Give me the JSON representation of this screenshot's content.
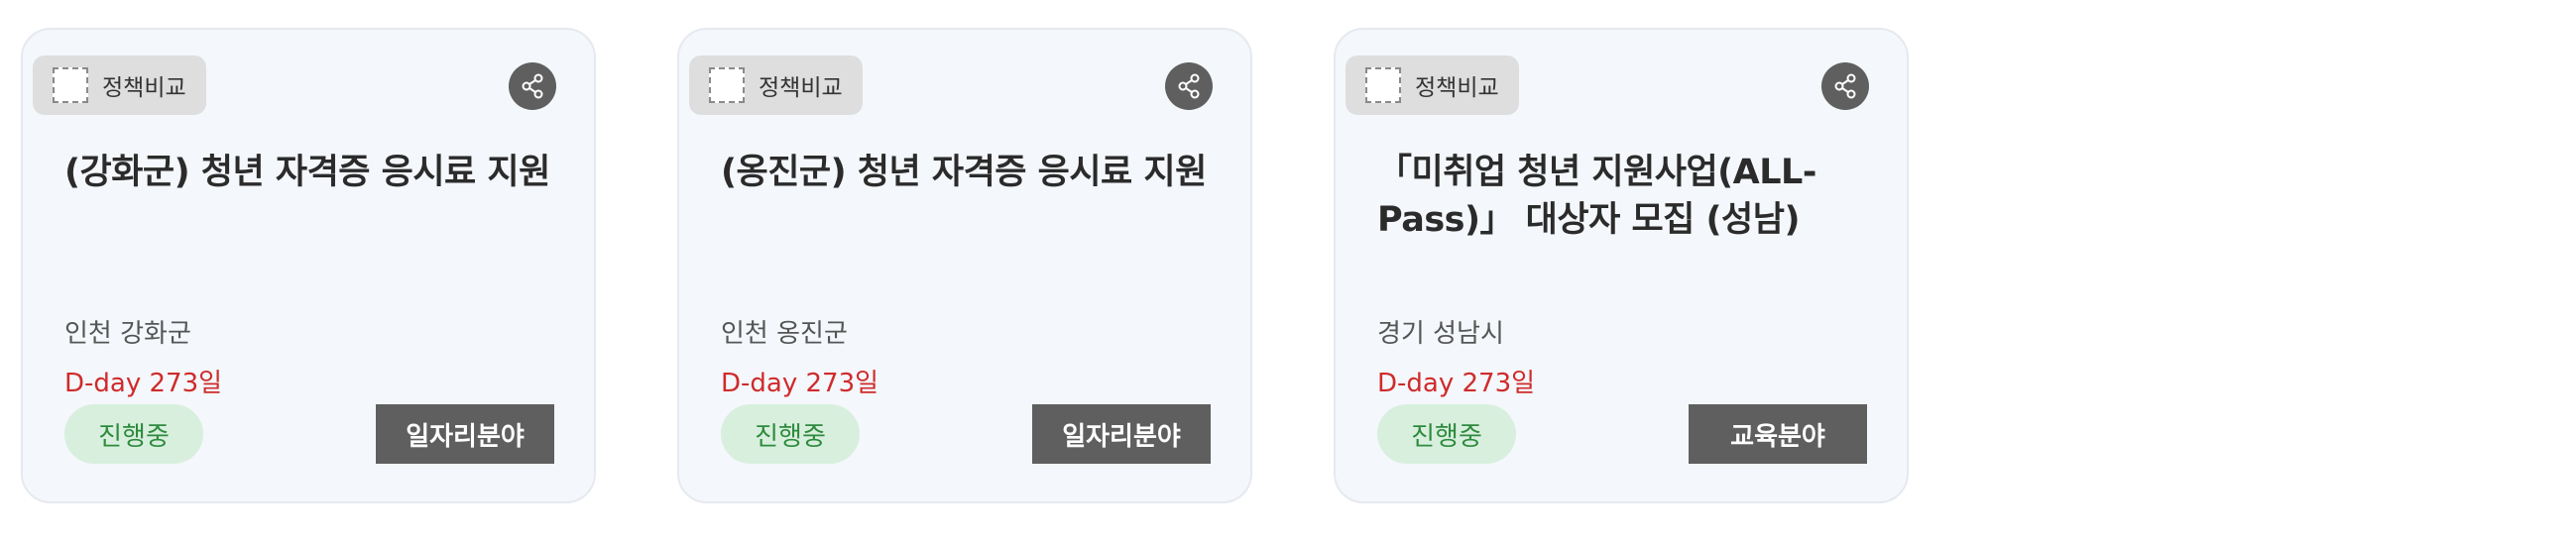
{
  "cards": [
    {
      "compare_label": "정책비교",
      "share_icon": "share-icon",
      "title": "(강화군) 청년 자격증 응시료 지원",
      "region": "인천 강화군",
      "dday": "D-day 273일",
      "status": "진행중",
      "field": "일자리분야"
    },
    {
      "compare_label": "정책비교",
      "share_icon": "share-icon",
      "title": "(옹진군) 청년 자격증 응시료 지원",
      "region": "인천 옹진군",
      "dday": "D-day 273일",
      "status": "진행중",
      "field": "일자리분야"
    },
    {
      "compare_label": "정책비교",
      "share_icon": "share-icon",
      "title": "「미취업 청년 지원사업(ALL-Pass)」 대상자 모집 (성남)",
      "region": "경기 성남시",
      "dday": "D-day 273일",
      "status": "진행중",
      "field": "교육분야"
    }
  ],
  "colors": {
    "card_bg": "#f4f7fb",
    "dday": "#cf2b2b",
    "status_bg": "#d8efde",
    "status_text": "#2e8b3d",
    "field_button_bg": "#5f5f5f"
  }
}
